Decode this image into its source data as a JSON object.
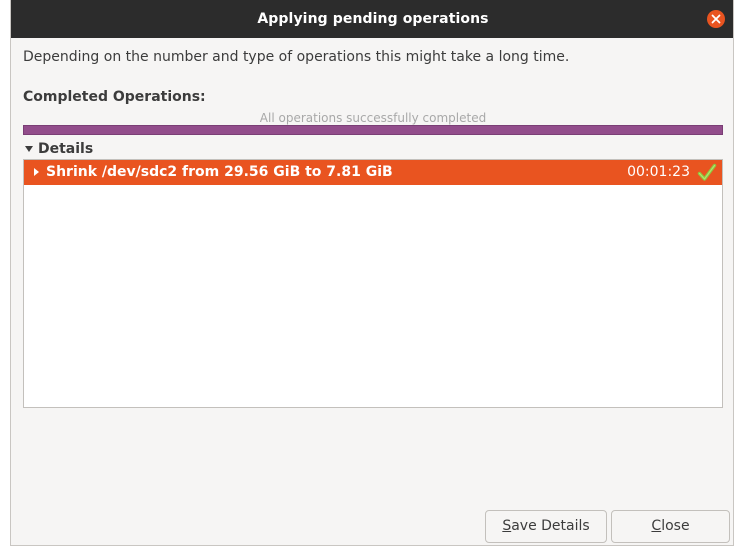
{
  "window": {
    "title": "Applying pending operations"
  },
  "description": "Depending on the number and type of operations this might take a long time.",
  "completed_label": "Completed Operations:",
  "progress": {
    "status_text": "All operations successfully completed",
    "fraction": 1.0
  },
  "details": {
    "label": "Details",
    "expanded": true,
    "operations": [
      {
        "label": "Shrink /dev/sdc2 from 29.56 GiB to 7.81 GiB",
        "duration": "00:01:23",
        "status_icon": "check-icon",
        "expanded": false
      }
    ]
  },
  "buttons": {
    "save_details": {
      "mnemonic": "S",
      "rest": "ave Details"
    },
    "close": {
      "mnemonic": "C",
      "rest": "lose"
    }
  },
  "colors": {
    "accent": "#e95420",
    "progress": "#924d8b",
    "success_check": "#8ec63f",
    "titlebar": "#2c2c2c"
  }
}
